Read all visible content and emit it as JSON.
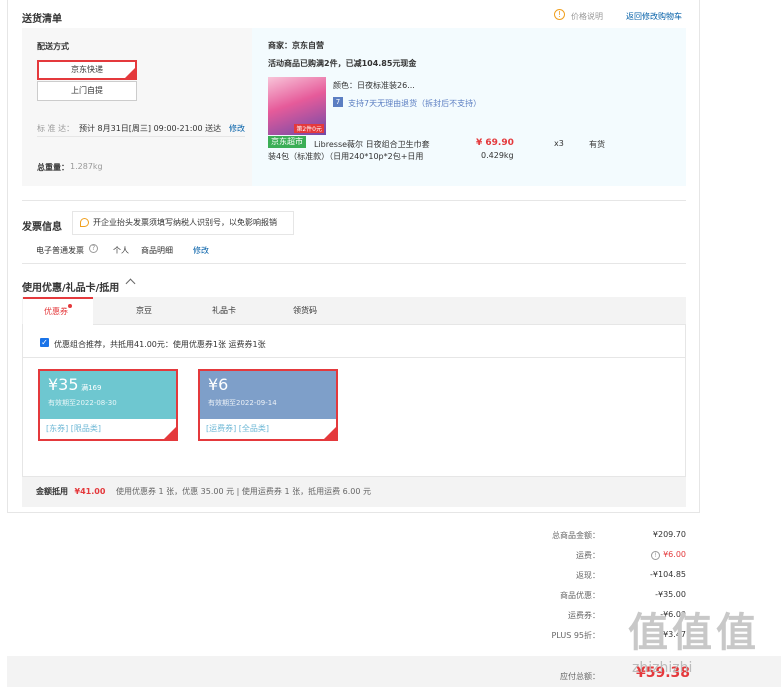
{
  "header": {
    "title": "送货清单",
    "price_note": "价格说明",
    "back_link": "返回修改购物车"
  },
  "shipping": {
    "method_label": "配送方式",
    "option_express": "京东快递",
    "option_pickup": "上门自提",
    "time_label": "标 准 达：",
    "time_value": "预计 8月31日[周三] 09:00-21:00 送达",
    "modify": "修改",
    "weight_label": "总重量：",
    "weight_value": "1.287kg"
  },
  "shop": {
    "merchant": "商家：京东自营",
    "promo": "活动商品已购满2件，已减104.85元现金",
    "color": "颜色：日夜标准装26...",
    "return_policy": "支持7天无理由退货（拆封后不支持）",
    "item_badge": "京东超市",
    "item_name_line1": "Libresse薇尔 日夜组合卫生巾套",
    "item_name_line2": "装4包（标准款）（日用240*10p*2包+日用",
    "price": "¥ 69.90",
    "qty": "x3",
    "stock": "有货",
    "weight": "0.429kg",
    "thumb_text": "第2件0元"
  },
  "invoice": {
    "title": "发票信息",
    "tip": "开企业抬头发票须填写纳税人识别号，以免影响报销",
    "type": "电子普通发票",
    "holder": "个人",
    "detail": "商品明细",
    "modify": "修改"
  },
  "discount": {
    "title": "使用优惠/礼品卡/抵用",
    "tabs": [
      "优惠券",
      "京豆",
      "礼品卡",
      "领货码"
    ],
    "recommend": "优惠组合推荐，共抵用41.00元：使用优惠券1张 运费券1张",
    "coupons": [
      {
        "amount": "¥35",
        "cond": "满169",
        "valid": "有效期至2022-08-30",
        "tags": "[东券]  [限品类]",
        "color": "#6ec7d0"
      },
      {
        "amount": "¥6",
        "cond": "",
        "valid": "有效期至2022-09-14",
        "tags": "[运费券]  [全品类]",
        "color": "#7e9fc9"
      }
    ],
    "summary_label": "金额抵用",
    "summary_amount": "¥41.00",
    "summary_detail": "使用优惠券 1 张，优惠 35.00 元  | 使用运费券 1 张，抵用运费 6.00 元"
  },
  "totals": [
    {
      "label": "总商品金额：",
      "value": "¥209.70",
      "color": "#333"
    },
    {
      "label": "运费：",
      "value": "¥6.00",
      "color": "#e4393c"
    },
    {
      "label": "返现：",
      "value": "-¥104.85",
      "color": "#333"
    },
    {
      "label": "商品优惠：",
      "value": "-¥35.00",
      "color": "#333"
    },
    {
      "label": "运费券：",
      "value": "-¥6.00",
      "color": "#333"
    },
    {
      "label": "PLUS 95折：",
      "value": "-¥3.47",
      "color": "#333"
    }
  ],
  "payable": {
    "label": "应付总额：",
    "value": "¥59.38"
  },
  "watermark": {
    "chars": "值值值",
    "url": "zhizhizhi"
  }
}
